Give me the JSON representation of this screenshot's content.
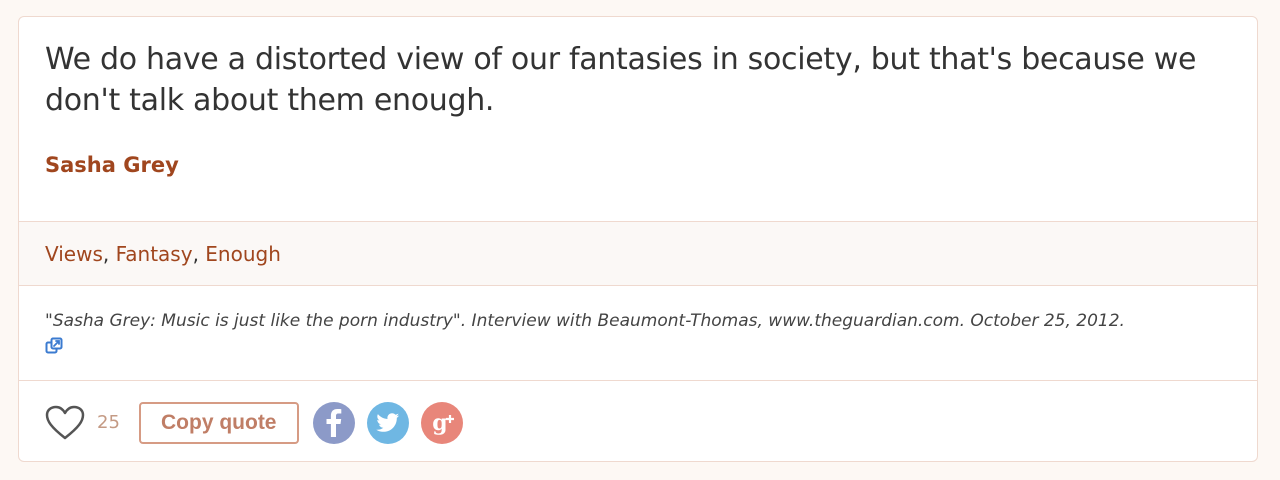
{
  "quote": {
    "text": "We do have a distorted view of our fantasies in society, but that's because we don't talk about them enough.",
    "author": "Sasha Grey"
  },
  "tags": {
    "items": [
      "Views",
      "Fantasy",
      "Enough"
    ],
    "separator": ","
  },
  "source": {
    "text": "\"Sasha Grey: Music is just like the porn industry\". Interview with Beaumont-Thomas, www.theguardian.com. October 25, 2012."
  },
  "actions": {
    "like_count": "25",
    "copy_label": "Copy quote",
    "icons": {
      "like": "heart-icon",
      "facebook": "facebook-icon",
      "twitter": "twitter-icon",
      "google_plus": "google-plus-icon",
      "source_link": "external-link-icon"
    }
  },
  "colors": {
    "accent": "#a0461e",
    "facebook": "#8c9ac8",
    "twitter": "#6fb7e3",
    "google_plus": "#e8867a"
  }
}
